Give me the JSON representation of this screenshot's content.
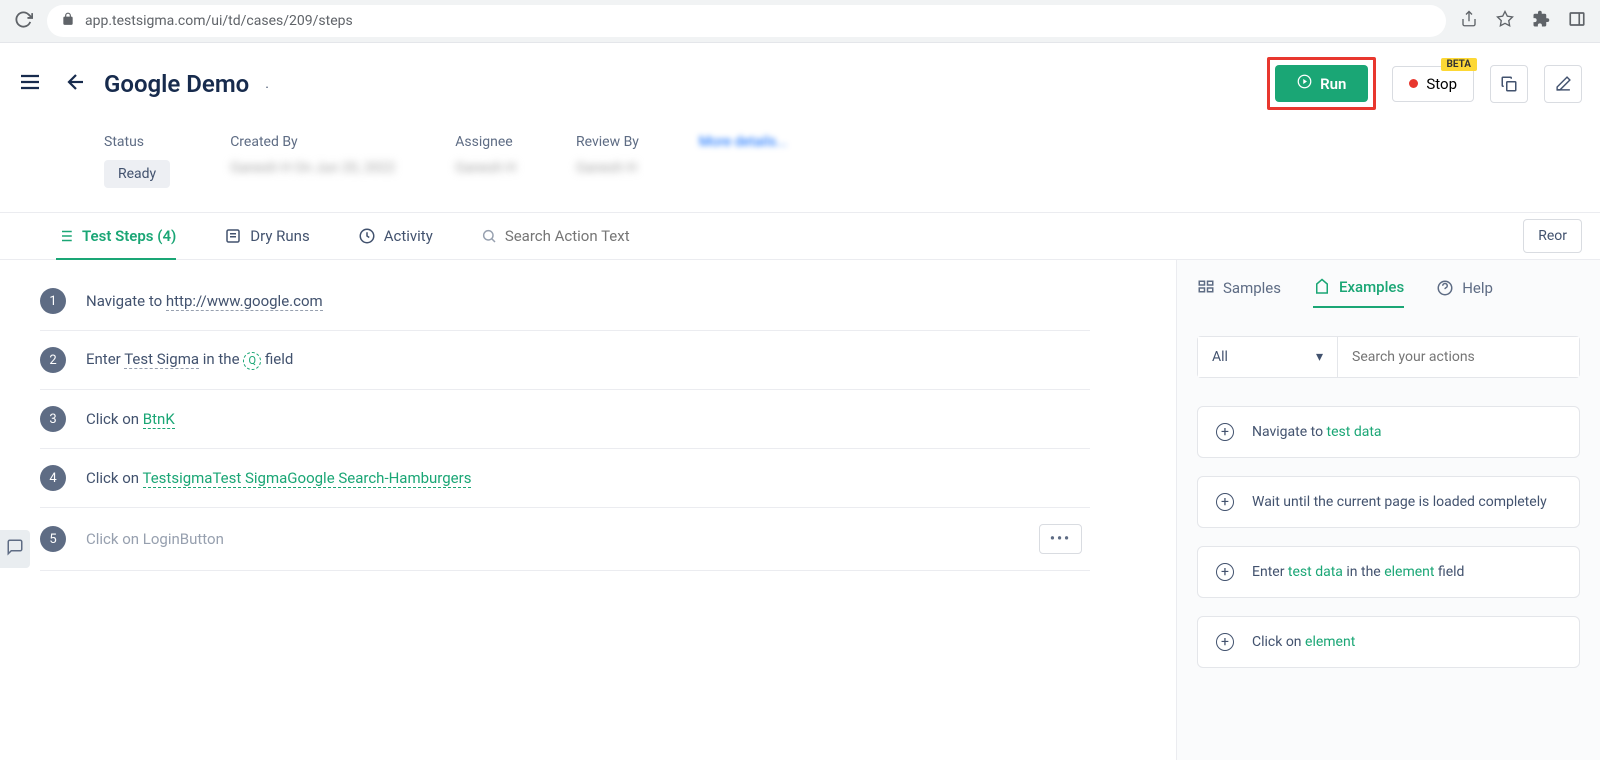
{
  "browser": {
    "url": "app.testsigma.com/ui/td/cases/209/steps"
  },
  "header": {
    "title": "Google Demo",
    "run_label": "Run",
    "stop_label": "Stop",
    "beta_label": "BETA"
  },
  "meta": {
    "status_label": "Status",
    "status_value": "Ready",
    "created_by_label": "Created By",
    "created_by_value": "Ganesh H On Jun 20, 2022",
    "assignee_label": "Assignee",
    "assignee_value": "Ganesh H",
    "review_by_label": "Review By",
    "review_by_value": "Ganesh H",
    "more_details": "More details..."
  },
  "tabs": {
    "test_steps": "Test Steps (4)",
    "dry_runs": "Dry Runs",
    "activity": "Activity",
    "search_placeholder": "Search Action Text",
    "reorder": "Reor"
  },
  "steps": [
    {
      "num": "1",
      "prefix": "Navigate to ",
      "link": "http://www.google.com",
      "link_style": "dark"
    },
    {
      "num": "2",
      "prefix": "Enter ",
      "link": "Test Sigma",
      "link_style": "dark",
      "mid": " in the ",
      "icon": "Q",
      "suffix": " field"
    },
    {
      "num": "3",
      "prefix": "Click on ",
      "link": "BtnK",
      "link_style": "green"
    },
    {
      "num": "4",
      "prefix": "Click on ",
      "link": "TestsigmaTest SigmaGoogle Search-Hamburgers",
      "link_style": "green"
    },
    {
      "num": "5",
      "prefix": "Click on LoginButton",
      "dim": true,
      "has_menu": true
    }
  ],
  "side": {
    "tabs": {
      "samples": "Samples",
      "examples": "Examples",
      "help": "Help"
    },
    "filter_all": "All",
    "search_placeholder": "Search your actions",
    "examples": [
      {
        "parts": [
          {
            "t": "Navigate to "
          },
          {
            "t": "test data",
            "c": "token-green"
          }
        ]
      },
      {
        "parts": [
          {
            "t": "Wait until the current page is loaded completely"
          }
        ]
      },
      {
        "parts": [
          {
            "t": "Enter "
          },
          {
            "t": "test data",
            "c": "token-green"
          },
          {
            "t": " in the "
          },
          {
            "t": "element",
            "c": "token-green"
          },
          {
            "t": " field"
          }
        ]
      },
      {
        "parts": [
          {
            "t": "Click on "
          },
          {
            "t": "element",
            "c": "token-green"
          }
        ]
      }
    ]
  }
}
